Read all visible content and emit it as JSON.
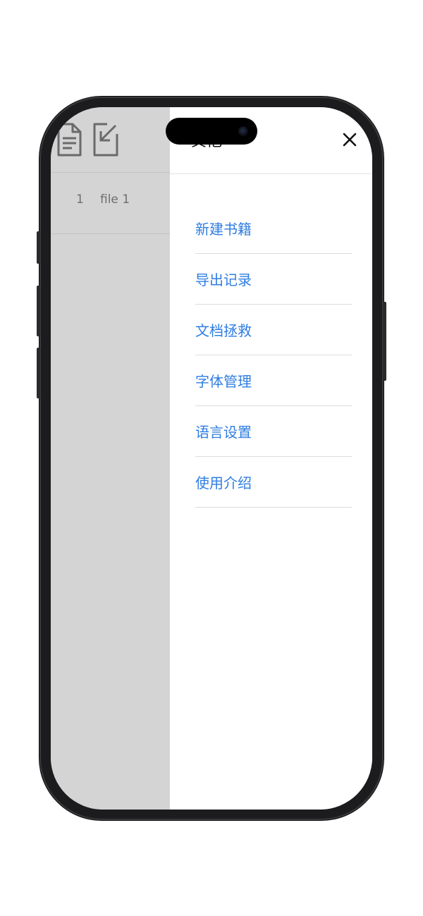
{
  "backdrop": {
    "toolbar_icons": [
      "document-icon",
      "import-icon"
    ],
    "files": [
      {
        "index": "1",
        "name": "file 1"
      }
    ]
  },
  "panel": {
    "title": "其他",
    "close_icon": "close-icon",
    "menu_items": [
      {
        "label": "新建书籍"
      },
      {
        "label": "导出记录"
      },
      {
        "label": "文档拯救"
      },
      {
        "label": "字体管理"
      },
      {
        "label": "语言设置"
      },
      {
        "label": "使用介绍"
      }
    ]
  },
  "colors": {
    "accent": "#2f7de1",
    "backdrop": "#d4d4d4",
    "divider": "#dcdcdc"
  }
}
